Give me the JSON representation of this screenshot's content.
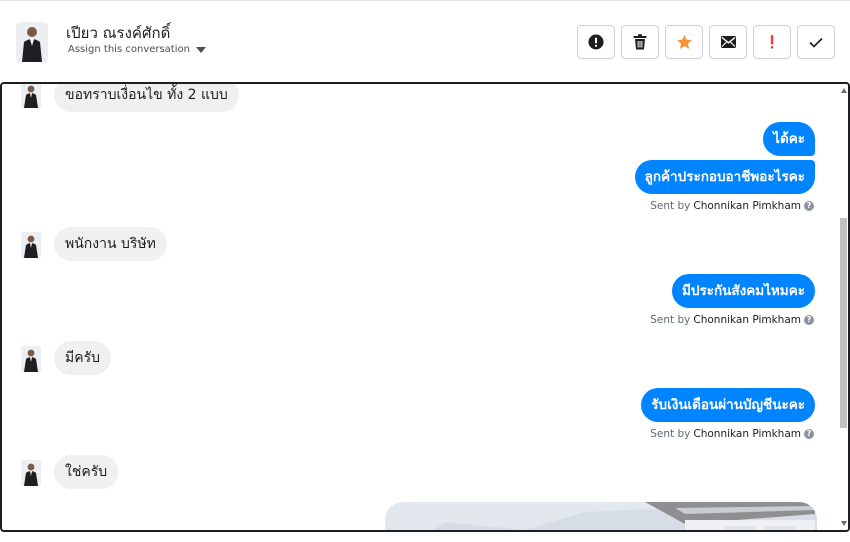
{
  "header": {
    "contact_name": "เปียว ณรงค์ศักดิ์",
    "assign_label": "Assign this conversation",
    "actions": [
      {
        "name": "mark-spam-button",
        "icon": "alert-circle-icon"
      },
      {
        "name": "delete-button",
        "icon": "trash-icon"
      },
      {
        "name": "star-button",
        "icon": "star-icon",
        "color": "#f7923b"
      },
      {
        "name": "mark-unread-button",
        "icon": "envelope-icon"
      },
      {
        "name": "follow-up-button",
        "icon": "exclamation-icon",
        "color": "#fa383e"
      },
      {
        "name": "mark-done-button",
        "icon": "checkmark-icon"
      }
    ]
  },
  "messages": {
    "m1": "ขอทราบเงื่อนไข ทั้ง 2 แบบ",
    "m2": "ได้คะ",
    "m3": "ลูกค้าประกอบอาชีพอะไรคะ",
    "m4": "พนักงาน บริษัท",
    "m5": "มีประกันสังคมไหมคะ",
    "m6": "มีครับ",
    "m7": "รับเงินเดือนผ่านบัญชีนะคะ",
    "m8": "ใช่ครับ"
  },
  "sent_by": {
    "prefix": "Sent by",
    "agent": "Chonnikan Pimkham"
  },
  "colors": {
    "outgoing_bubble": "#0084ff",
    "incoming_bubble": "#f1f0f0",
    "star": "#f7923b",
    "flag": "#fa383e"
  }
}
